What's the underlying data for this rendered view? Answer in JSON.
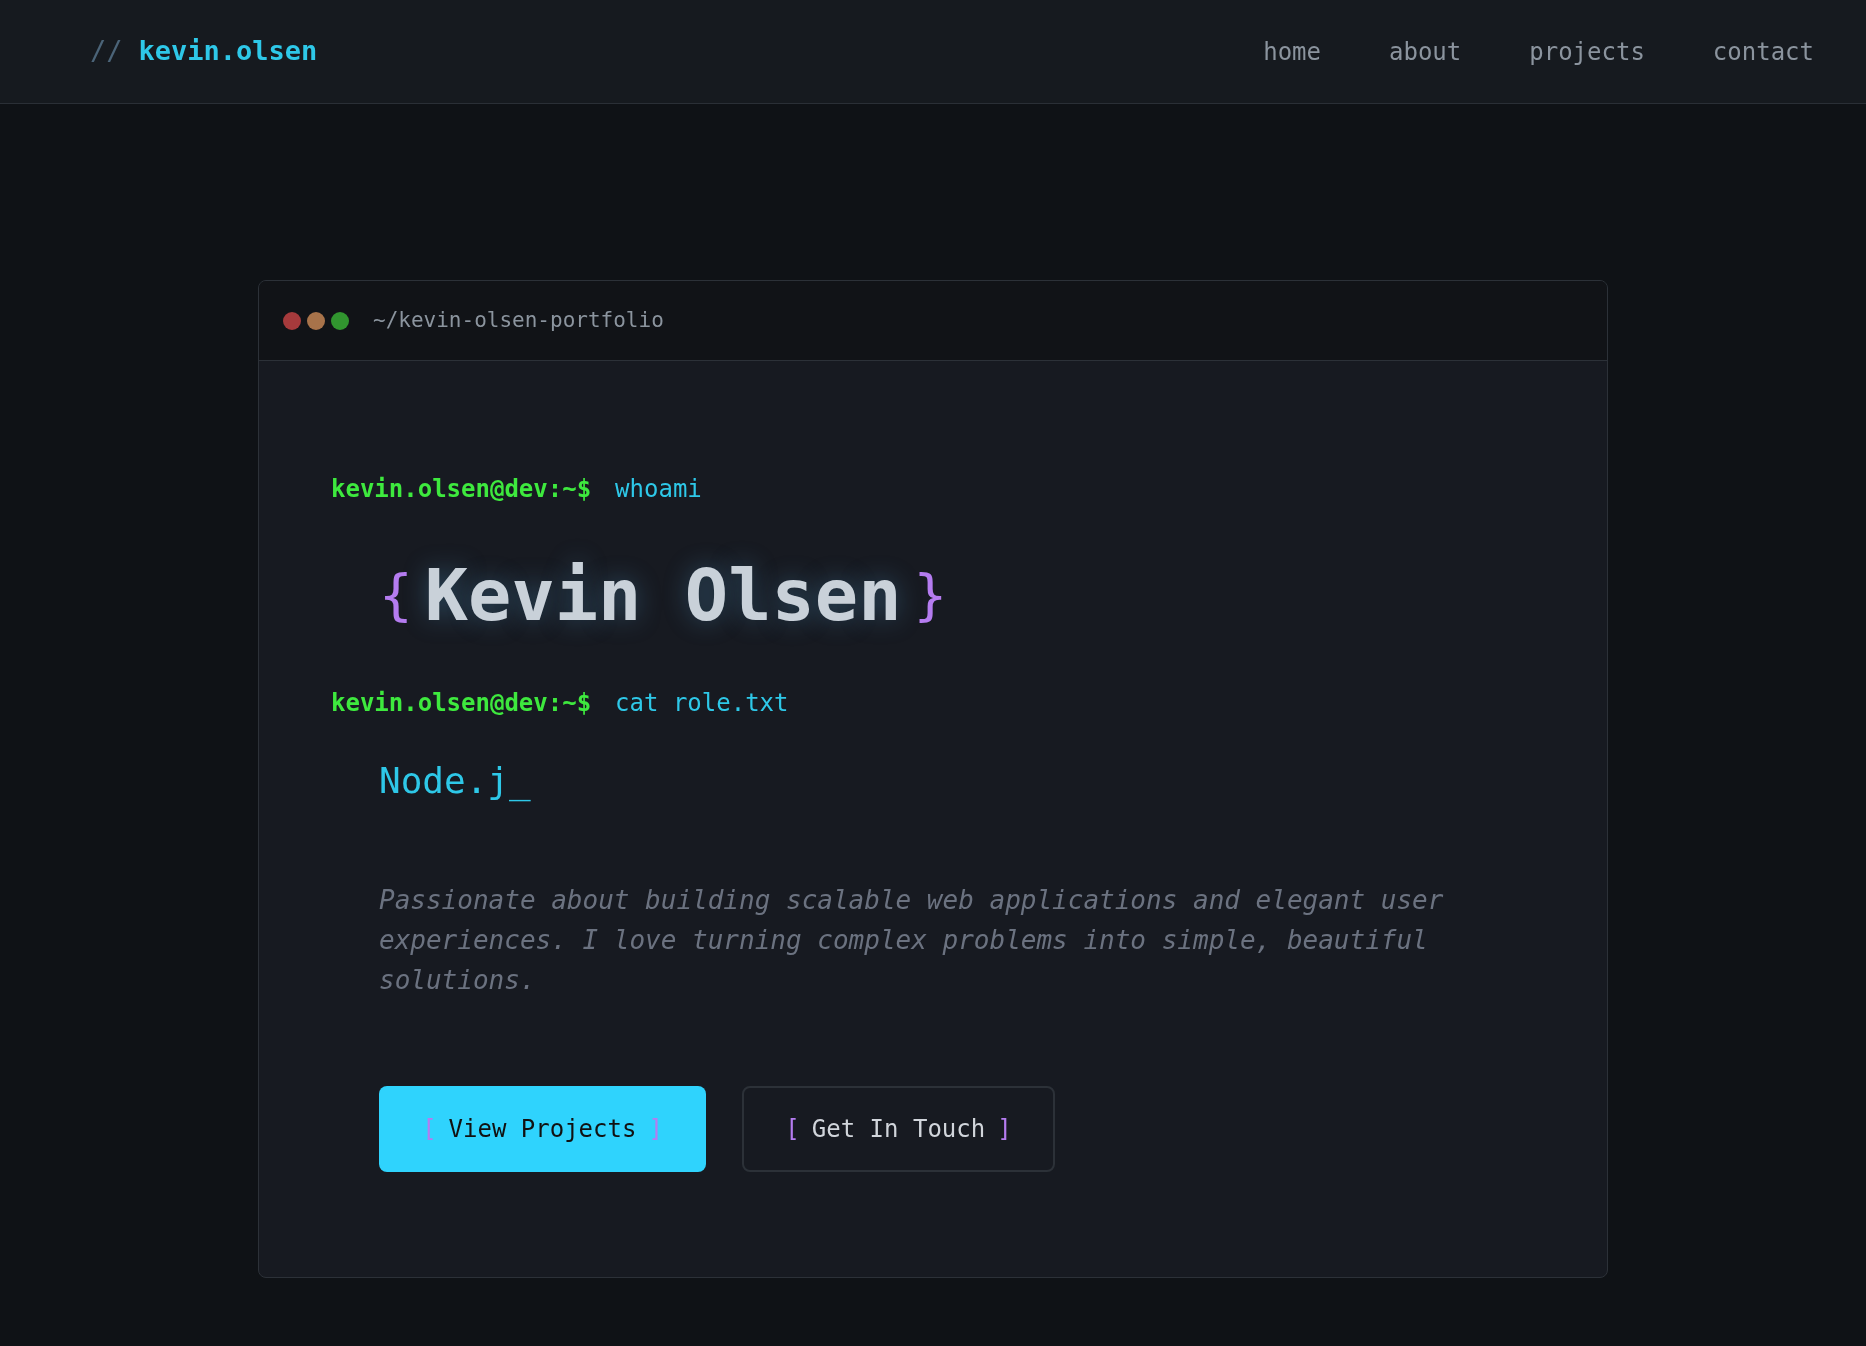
{
  "header": {
    "logo_prefix": "//",
    "logo": "kevin.olsen",
    "nav": [
      {
        "label": "home"
      },
      {
        "label": "about"
      },
      {
        "label": "projects"
      },
      {
        "label": "contact"
      }
    ]
  },
  "terminal": {
    "path": "~/kevin-olsen-portfolio",
    "lines": [
      {
        "kind": "prompt",
        "prompt": "kevin.olsen@dev:~$",
        "command": "whoami"
      },
      {
        "kind": "heading",
        "open": "{",
        "text": "Kevin Olsen",
        "close": "}"
      },
      {
        "kind": "prompt",
        "prompt": "kevin.olsen@dev:~$",
        "command": "cat role.txt"
      },
      {
        "kind": "typed",
        "text": "Node.j_"
      },
      {
        "kind": "paragraph",
        "text": "Passionate about building scalable web applications and elegant user experiences. I love turning complex problems into simple, beautiful solutions."
      }
    ],
    "buttons": [
      {
        "kind": "primary",
        "open": "[",
        "label": "View Projects",
        "close": "]"
      },
      {
        "kind": "outline",
        "open": "[",
        "label": "Get In Touch",
        "close": "]"
      }
    ]
  }
}
